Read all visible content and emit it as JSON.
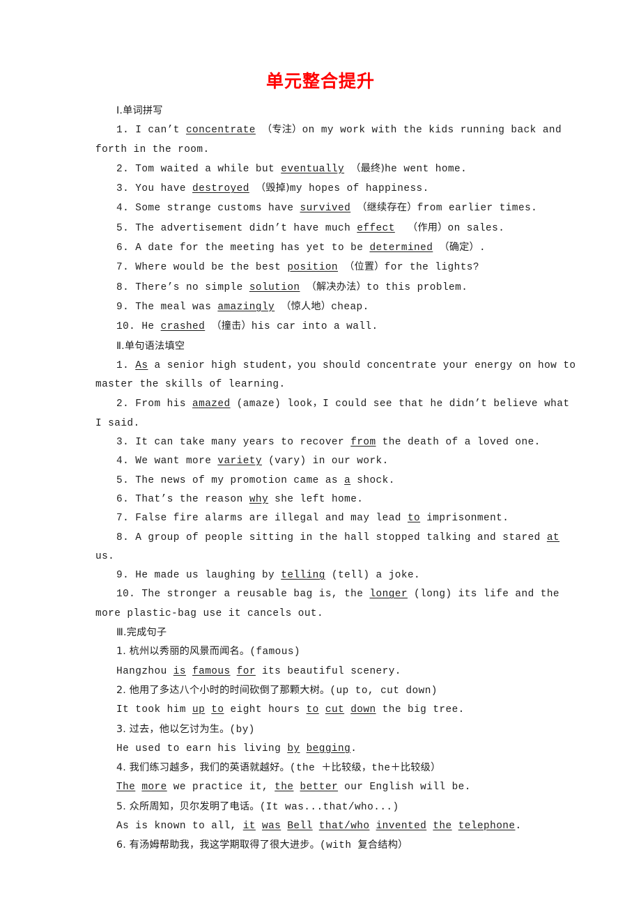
{
  "document": {
    "title": "单元整合提升",
    "title_color": "#ff0000",
    "page_background": "#ffffff",
    "text_color": "#1c1c1c"
  },
  "sections": [
    {
      "heading": "Ⅰ.单词拼写",
      "items": [
        "1. I can't concentrate（专注）on my work with the kids running back and forth in the room.",
        "2. Tom waited a while but eventually（最终)he went home.",
        "3. You have destroyed（毁掉)my hopes of happiness.",
        "4. Some strange customs have survived（继续存在）from earlier times.",
        "5. The advertisement didn't have much effect （作用）on sales.",
        "6. A date for the meeting has yet to be determined（确定）.",
        "7. Where would be the best position（位置）for the lights?",
        "8. There's no simple solution（解决办法）to this problem.",
        "9. The meal was amazingly（惊人地）cheap.",
        "10. He crashed（撞击）his car into a wall."
      ]
    },
    {
      "heading": "Ⅱ.单句语法填空",
      "items": [
        "1. As a senior high student，you should concentrate your energy on how to master the skills of learning.",
        "2. From his amazed (amaze) look，I could see that he didn't believe what I said.",
        "3. It can take many years to recover from the death of a loved one.",
        "4. We want more variety (vary) in our work.",
        "5. The news of my promotion came as a shock.",
        "6. That's the reason why she left home.",
        "7. False fire alarms are illegal and may lead to imprisonment.",
        "8. A group of people sitting in the hall stopped talking and stared at us.",
        "9. He made us laughing by telling (tell) a joke.",
        "10. The stronger a reusable bag is, the longer (long) its life and the more plastic-bag use it cancels out."
      ]
    },
    {
      "heading": "Ⅲ.完成句子",
      "pairs": [
        {
          "prompt": "1. 杭州以秀丽的风景而闻名。(famous)",
          "answer": "Hangzhou is famous for its beautiful scenery."
        },
        {
          "prompt": "2. 他用了多达八个小时的时间砍倒了那颗大树。(up to, cut down)",
          "answer": "It took him up to eight hours to cut down the big tree."
        },
        {
          "prompt": "3. 过去，他以乞讨为生。(by)",
          "answer": "He used to earn his living by begging."
        },
        {
          "prompt": "4. 我们练习越多，我们的英语就越好。(the ＋比较级，the＋比较级)",
          "answer": "The more we practice it, the better our English will be."
        },
        {
          "prompt": "5. 众所周知，贝尔发明了电话。(It was...that/who...)",
          "answer": "As is known to all, it was Bell that/who invented the telephone."
        },
        {
          "prompt": "6. 有汤姆帮助我，我这学期取得了很大进步。(with 复合结构)",
          "answer": ""
        }
      ]
    }
  ],
  "answers_underlined": {
    "s1": [
      "concentrate",
      "eventually",
      "destroyed",
      "survived",
      "effect",
      "determined",
      "position",
      "solution",
      "amazingly",
      "crashed"
    ],
    "s2": [
      "As",
      "amazed",
      "from",
      "variety",
      "a",
      "why",
      "to",
      "at",
      "telling",
      "longer"
    ],
    "s3": [
      "is famous for",
      "up to / to cut down",
      "by begging",
      "The more / the better",
      "it was Bell that/who invented the telephone"
    ]
  }
}
